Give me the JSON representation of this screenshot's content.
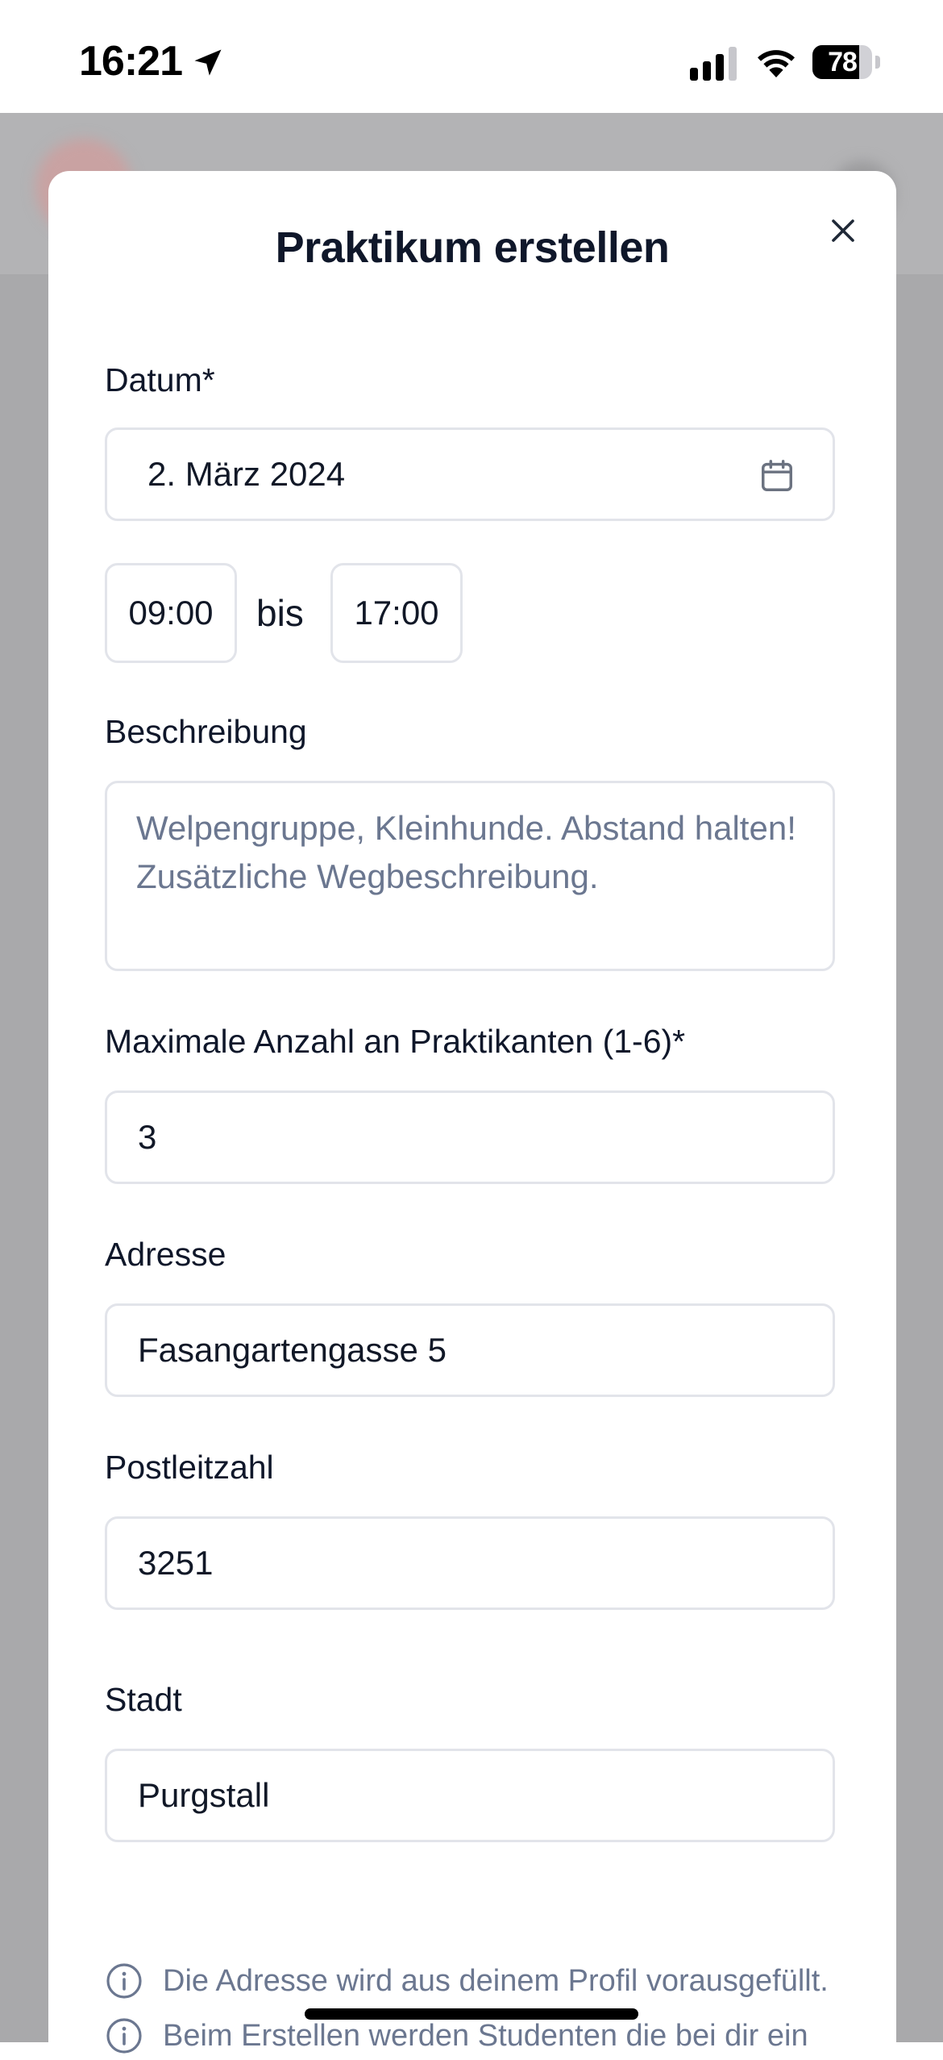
{
  "status_bar": {
    "time": "16:21",
    "battery_level": "78",
    "battery_fraction": 0.78,
    "icons": [
      "location-arrow-icon",
      "cellular-signal-icon",
      "wifi-icon",
      "battery-icon"
    ]
  },
  "modal": {
    "title": "Praktikum erstellen",
    "close_icon": "close-icon"
  },
  "form": {
    "date": {
      "label": "Datum*",
      "value": "2. März 2024",
      "icon": "calendar-icon"
    },
    "time": {
      "start": "09:00",
      "separator": "bis",
      "end": "17:00"
    },
    "description": {
      "label": "Beschreibung",
      "placeholder": "Welpengruppe, Kleinhunde. Abstand halten! Zusätzliche Wegbeschreibung."
    },
    "max_interns": {
      "label": "Maximale Anzahl an Praktikanten (1-6)*",
      "value": "3"
    },
    "address": {
      "label": "Adresse",
      "value": "Fasangartengasse 5"
    },
    "postal_code": {
      "label": "Postleitzahl",
      "value": "3251"
    },
    "city": {
      "label": "Stadt",
      "value": "Purgstall"
    }
  },
  "info_notes": [
    {
      "icon": "info-icon",
      "text": "Die Adresse wird aus deinem Profil vorausgefüllt."
    },
    {
      "icon": "info-icon",
      "text": "Beim Erstellen werden Studenten die bei dir ein"
    }
  ],
  "colors": {
    "backdrop": "#a9a9ab",
    "border": "#e2e4ea",
    "placeholder": "#6b7790",
    "text": "#0f172a"
  }
}
